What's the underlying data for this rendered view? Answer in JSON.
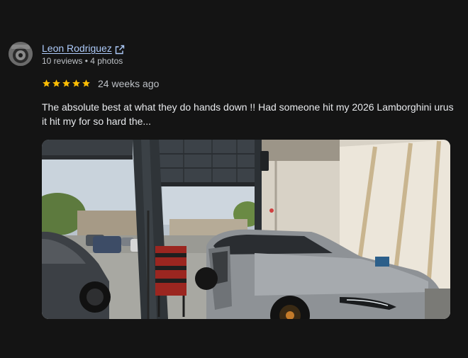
{
  "review": {
    "author": {
      "name": "Leon Rodriguez",
      "meta": "10 reviews • 4 photos",
      "link_icon": "open-in-new-icon"
    },
    "rating": {
      "stars": 5,
      "max": 5,
      "star_color": "#fbbc04"
    },
    "time_ago": "24 weeks ago",
    "text": "The absolute best at what they do hands down !! Had someone hit my 2026 Lamborghini urus it hit my for so hard the...",
    "photo": {
      "subject": "gray-sports-suv-in-garage"
    }
  }
}
